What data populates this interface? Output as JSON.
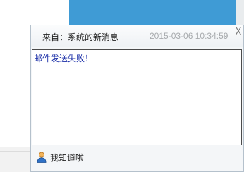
{
  "popup": {
    "title": "来自：系统的新消息",
    "timestamp": "2015-03-06 10:34:59",
    "close_label": "X",
    "message": "邮件发送失败！",
    "ack_label": "我知道啦"
  },
  "icons": {
    "close": "close-icon",
    "user": "user-icon"
  },
  "colors": {
    "background_accent": "#3f9bd5",
    "message_text": "#1b2fa8",
    "timestamp_text": "#a7aaad",
    "border": "#b5c1cc"
  }
}
